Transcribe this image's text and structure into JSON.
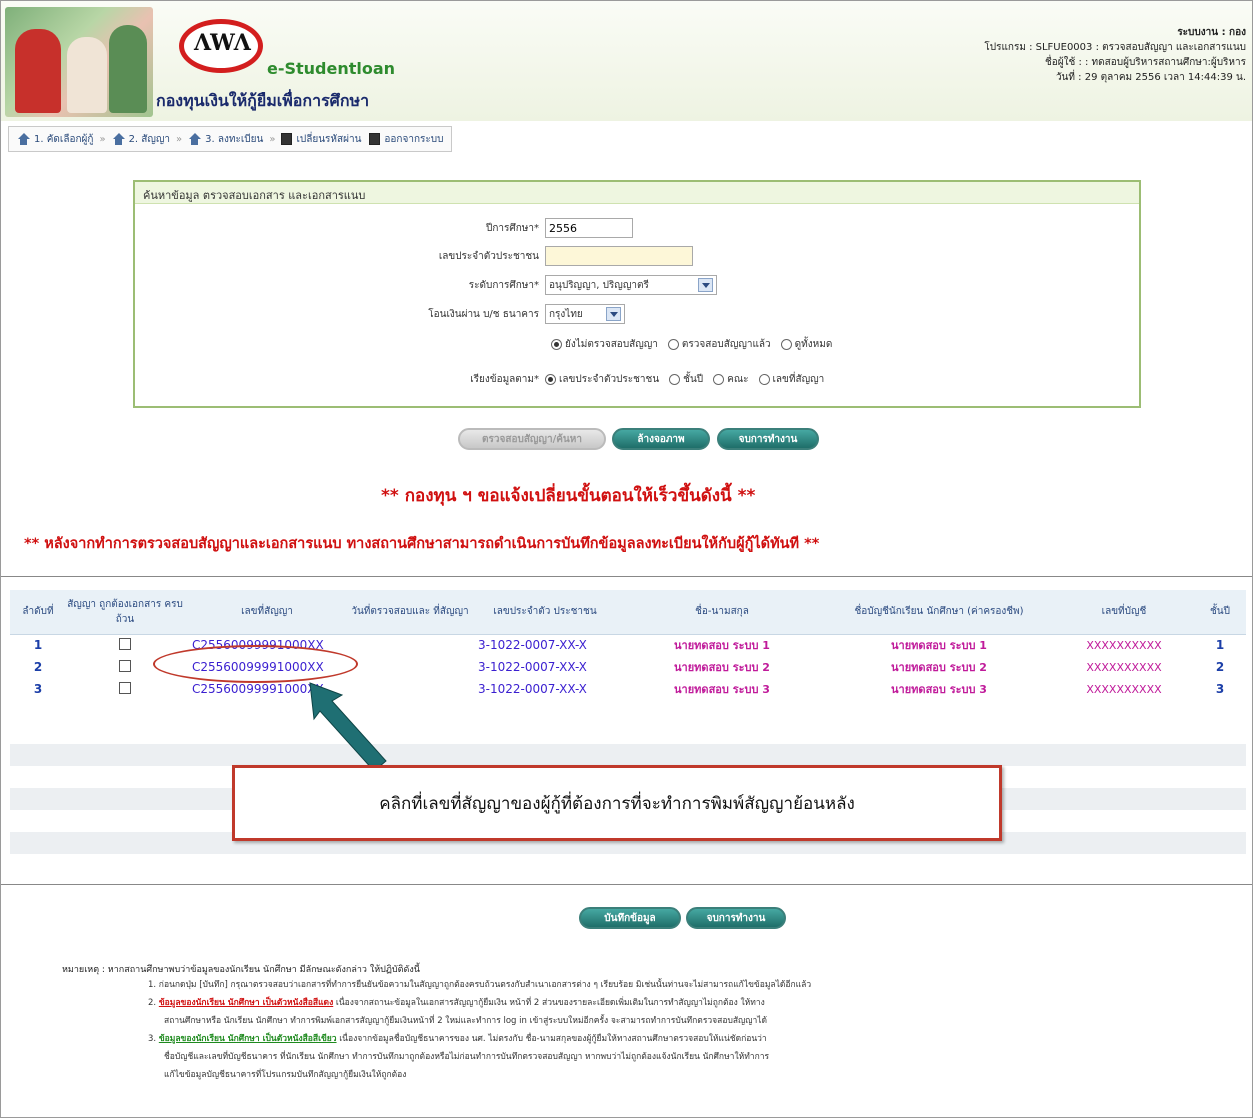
{
  "header": {
    "logo_text": "ΛWΛ",
    "studentloan": "e-Studentloan",
    "org_name": "กองทุนเงินให้กู้ยืมเพื่อการศึกษา",
    "system_label": "ระบบงาน : กอง",
    "program_label": "โปรแกรม : SLFUE0003 : ตรวจสอบสัญญา และเอกสารแนบ",
    "user_label": "ชื่อผู้ใช้ :",
    "user_value": ": ทดสอบผู้บริหารสถานศึกษา:ผู้บริหาร",
    "date_label": "วันที่ : 29 ตุลาคม 2556 เวลา 14:44:39 น."
  },
  "nav": {
    "items": [
      {
        "label": "1. คัดเลือกผู้กู้",
        "icon": "home-icon"
      },
      {
        "label": "2. สัญญา",
        "icon": "home-icon"
      },
      {
        "label": "3. ลงทะเบียน",
        "icon": "home-icon"
      },
      {
        "label": "เปลี่ยนรหัสผ่าน",
        "icon": "document-icon"
      },
      {
        "label": "ออกจากระบบ",
        "icon": "document-icon"
      }
    ]
  },
  "search": {
    "title": "ค้นหาข้อมูล ตรวจสอบเอกสาร และเอกสารแนบ",
    "academic_year_label": "ปีการศึกษา*",
    "academic_year_value": "2556",
    "citizen_id_label": "เลขประจำตัวประชาชน",
    "citizen_id_value": "",
    "level_label": "ระดับการศึกษา*",
    "level_value": "อนุปริญญา, ปริญญาตรี",
    "bank_label": "โอนเงินผ่าน บ/ช ธนาคาร",
    "bank_value": "กรุงไทย",
    "status_options": [
      "ยังไม่ตรวจสอบสัญญา",
      "ตรวจสอบสัญญาแล้ว",
      "ดูทั้งหมด"
    ],
    "sort_label": "เรียงข้อมูลตาม*",
    "sort_options": [
      "เลขประจำตัวประชาชน",
      "ชั้นปี",
      "คณะ",
      "เลขที่สัญญา"
    ]
  },
  "buttons": {
    "search": "ตรวจสอบสัญญา/ค้นหา",
    "clear": "ล้างจอภาพ",
    "exit": "จบการทำงาน",
    "save": "บันทึกข้อมูล",
    "exit2": "จบการทำงาน"
  },
  "notices": {
    "line1": "** กองทุน ฯ ขอแจ้งเปลี่ยนขั้นตอนให้เร็วขึ้นดังนี้ **",
    "line2": "** หลังจากทำการตรวจสอบสัญญาและเอกสารแนบ ทางสถานศึกษาสามารถดำเนินการบันทึกข้อมูลลงทะเบียนให้กับผู้กู้ได้ทันที **"
  },
  "table": {
    "headers": [
      "ลำดับที่",
      "สัญญา ถูกต้องเอกสาร ครบถ้วน",
      "เลขที่สัญญา",
      "วันที่ตรวจสอบและ ที่สัญญา",
      "เลขประจำตัว ประชาชน",
      "ชื่อ-นามสกุล",
      "ชื่อบัญชีนักเรียน นักศึกษา (ค่าครองชีพ)",
      "เลขที่บัญชี",
      "ชั้นปี"
    ],
    "rows": [
      {
        "no": "1",
        "contract": "C25560099991000XX",
        "citizen": "3-1022-0007-XX-X",
        "name": "นายทดสอบ ระบบ 1",
        "account_name": "นายทดสอบ ระบบ 1",
        "account_no": "XXXXXXXXXX",
        "year": "1"
      },
      {
        "no": "2",
        "contract": "C25560099991000XX",
        "citizen": "3-1022-0007-XX-X",
        "name": "นายทดสอบ ระบบ 2",
        "account_name": "นายทดสอบ ระบบ 2",
        "account_no": "XXXXXXXXXX",
        "year": "2"
      },
      {
        "no": "3",
        "contract": "C25560099991000XX",
        "citizen": "3-1022-0007-XX-X",
        "name": "นายทดสอบ ระบบ 3",
        "account_name": "นายทดสอบ ระบบ 3",
        "account_no": "XXXXXXXXXX",
        "year": "3"
      }
    ]
  },
  "callout": "คลิกที่เลขที่สัญญาของผู้กู้ที่ต้องการที่จะทำการพิมพ์สัญญาย้อนหลัง",
  "notes": {
    "title": "หมายเหตุ : หากสถานศึกษาพบว่าข้อมูลของนักเรียน นักศึกษา มีลักษณะดังกล่าว ให้ปฏิบัติดังนี้",
    "n1": "1. ก่อนกดปุ่ม [บันทึก] กรุณาตรวจสอบว่าเอกสารที่ทำการยืนยันข้อความในสัญญาถูกต้องครบถ้วนตรงกับสำเนาเอกสารต่าง ๆ เรียบร้อย มิเช่นนั้นท่านจะไม่สามารถแก้ไขข้อมูลได้อีกแล้ว",
    "n2_prefix": "2.",
    "n2_highlight": "ข้อมูลของนักเรียน นักศึกษา เป็นตัวหนังสือสีแดง",
    "n2_rest": " เนื่องจากสถานะข้อมูลในเอกสารสัญญากู้ยืมเงิน หน้าที่ 2 ส่วนของรายละเอียดเพิ่มเติมในการทำสัญญาไม่ถูกต้อง ให้ทาง",
    "n2_line2": "สถานศึกษาหรือ นักเรียน นักศึกษา ทำการพิมพ์เอกสารสัญญากู้ยืมเงินหน้าที่ 2 ใหม่และทำการ log in เข้าสู่ระบบใหม่อีกครั้ง จะสามารถทำการบันทึกตรวจสอบสัญญาได้",
    "n3_prefix": "3.",
    "n3_highlight": "ข้อมูลของนักเรียน นักศึกษา เป็นตัวหนังสือสีเขียว",
    "n3_rest": " เนื่องจากข้อมูลชื่อบัญชีธนาคารของ นศ. ไม่ตรงกับ ชื่อ-นามสกุลของผู้กู้ยืมให้ทางสถานศึกษาตรวจสอบให้แน่ชัดก่อนว่า",
    "n3_line2": "ชื่อบัญชีและเลขที่บัญชีธนาคาร ที่นักเรียน นักศึกษา ทำการบันทึกมาถูกต้องหรือไม่ก่อนทำการบันทึกตรวจสอบสัญญา หากพบว่าไม่ถูกต้องแจ้งนักเรียน นักศึกษาให้ทำการ",
    "n3_line3": "แก้ไขข้อมูลบัญชีธนาคารที่โปรแกรมบันทึกสัญญากู้ยืมเงินให้ถูกต้อง"
  }
}
